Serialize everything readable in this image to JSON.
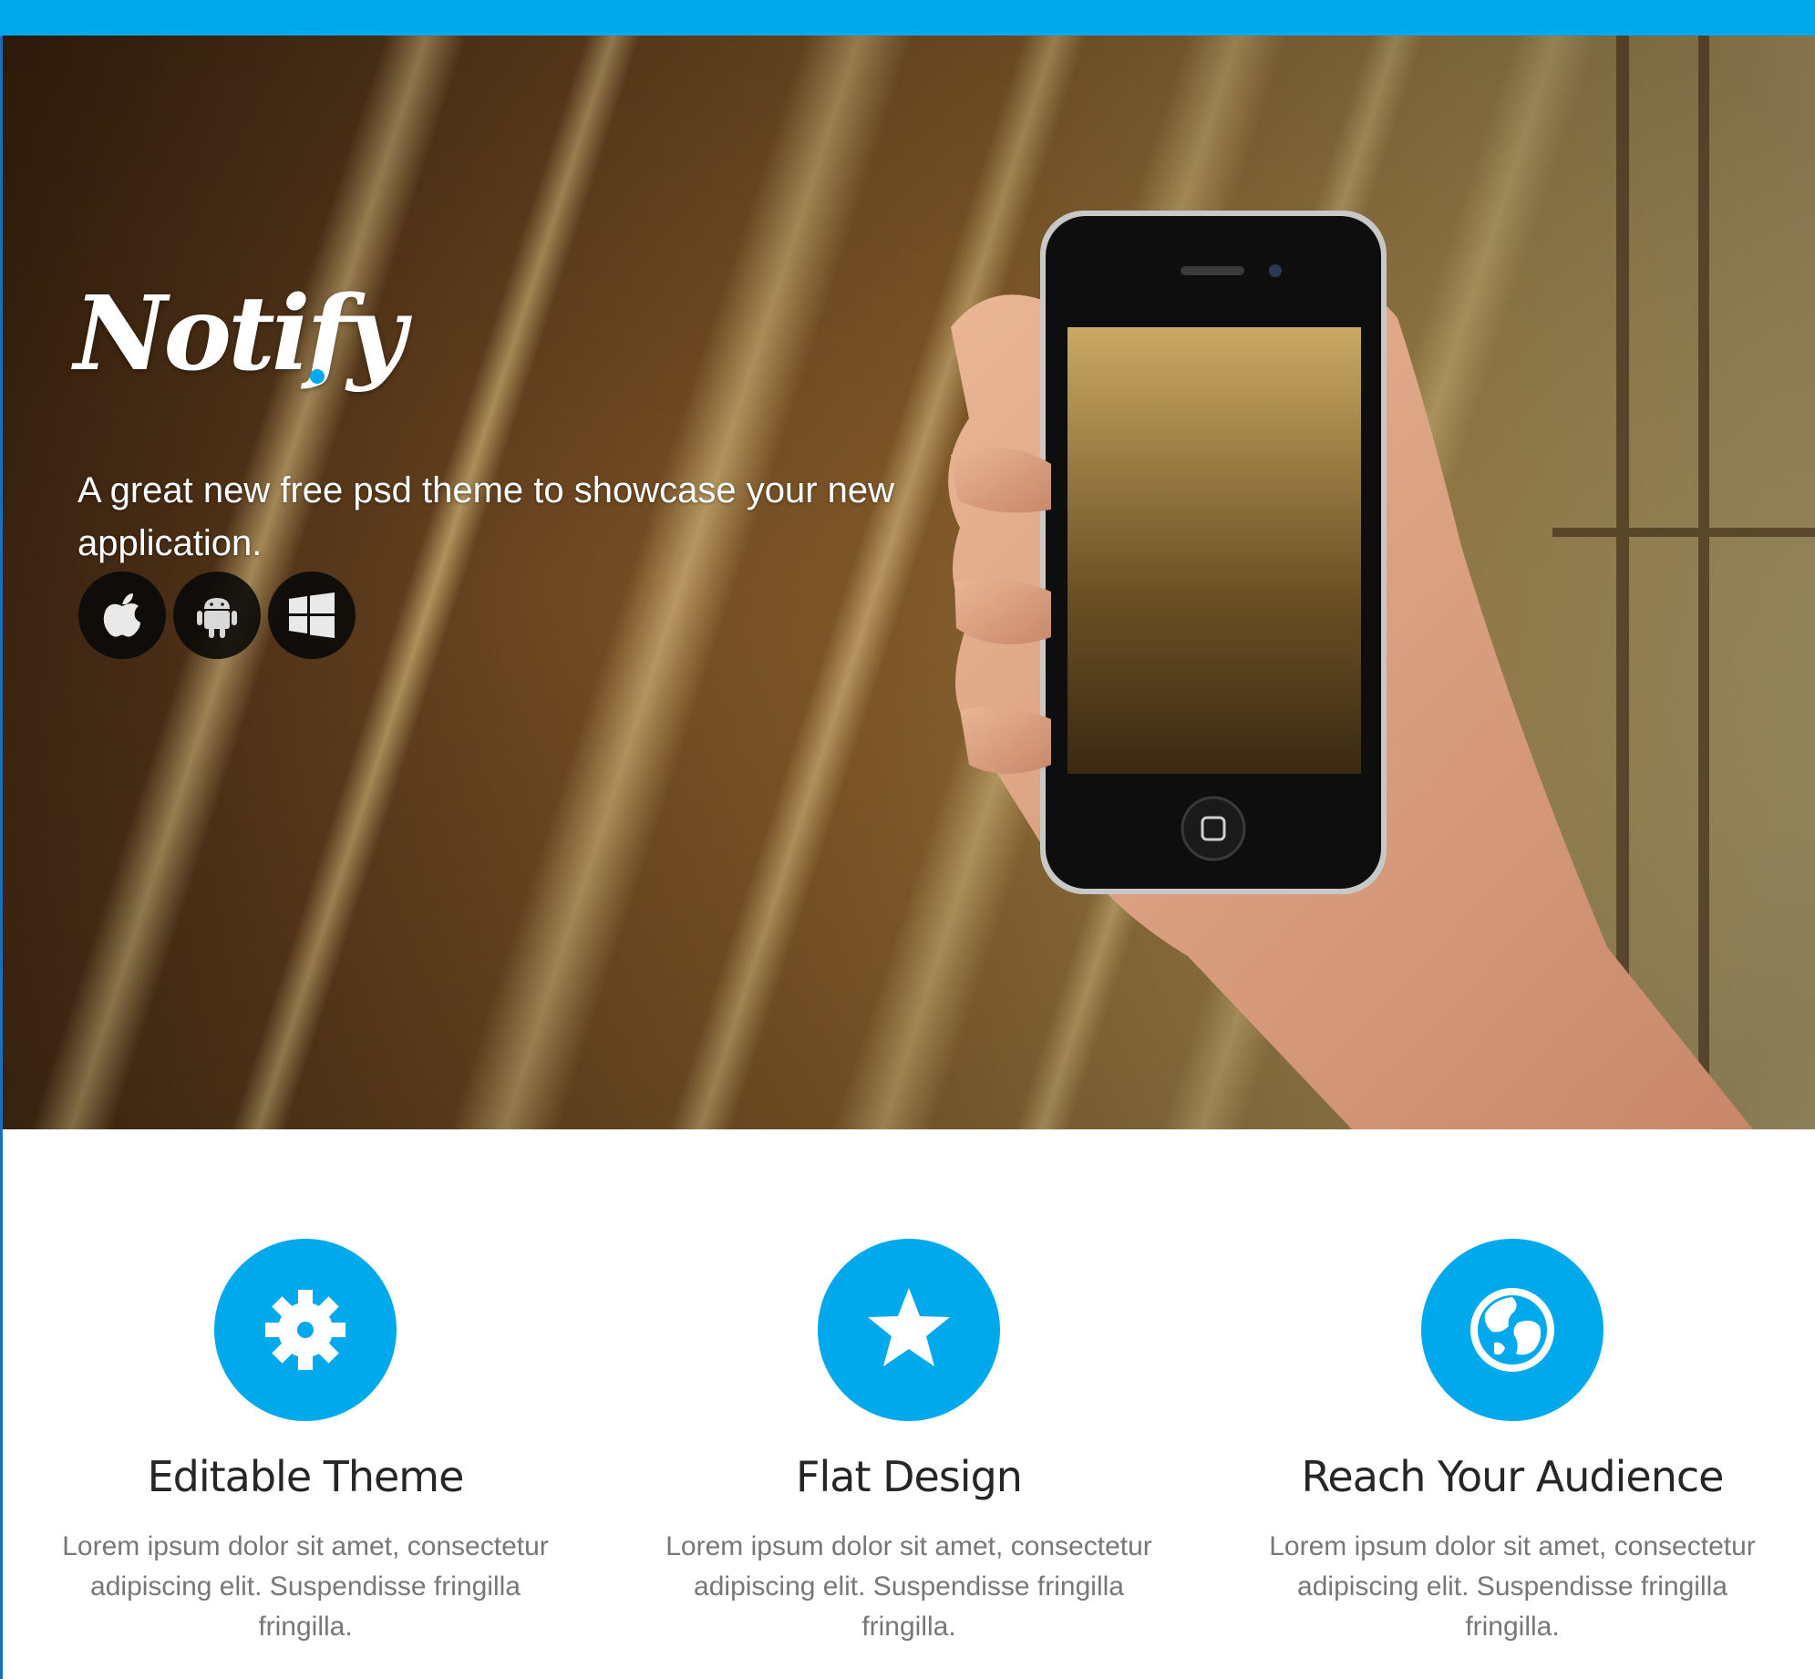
{
  "brand": {
    "logo": "Notify",
    "accent": "#00a8ec"
  },
  "hero": {
    "tagline": "A great new free psd theme to showcase your new application.",
    "platforms": [
      {
        "name": "apple-icon"
      },
      {
        "name": "android-icon"
      },
      {
        "name": "windows-icon"
      }
    ]
  },
  "features": [
    {
      "icon": "gear-icon",
      "title": "Editable Theme",
      "text": "Lorem ipsum dolor sit amet, consectetur adipiscing elit. Suspendisse fringilla fringilla."
    },
    {
      "icon": "star-icon",
      "title": "Flat Design",
      "text": "Lorem ipsum dolor sit amet, consectetur adipiscing elit. Suspendisse fringilla fringilla."
    },
    {
      "icon": "globe-icon",
      "title": "Reach Your Audience",
      "text": "Lorem ipsum dolor sit amet, consectetur adipiscing elit. Suspendisse fringilla fringilla."
    }
  ]
}
